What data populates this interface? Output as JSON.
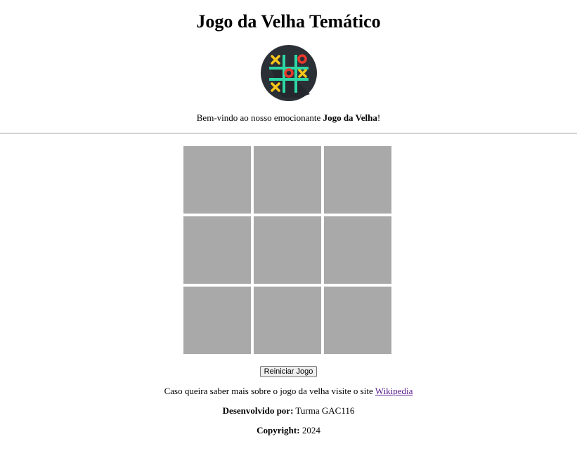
{
  "page": {
    "title": "Jogo da Velha Temático"
  },
  "logo": {
    "icon": "tic-tac-toe-logo-icon",
    "colors": {
      "background": "#2b2f36",
      "grid": "#2ed6a3",
      "x": "#f5c518",
      "o": "#e8382c"
    }
  },
  "welcome": {
    "prefix": "Bem-vindo ao nosso emocionante ",
    "highlight": "Jogo da Velha",
    "suffix": "!"
  },
  "board": {
    "cells": [
      "",
      "",
      "",
      "",
      "",
      "",
      "",
      "",
      ""
    ],
    "cell_color": "#a9a9a9"
  },
  "controls": {
    "restart_label": "Reiniciar Jogo"
  },
  "info": {
    "text": "Caso queira saber mais sobre o jogo da velha visite o site ",
    "link_label": "Wikipedia"
  },
  "credits": {
    "label": "Desenvolvido por:",
    "value": " Turma GAC116"
  },
  "copyright": {
    "label": "Copyright:",
    "value": " 2024"
  }
}
